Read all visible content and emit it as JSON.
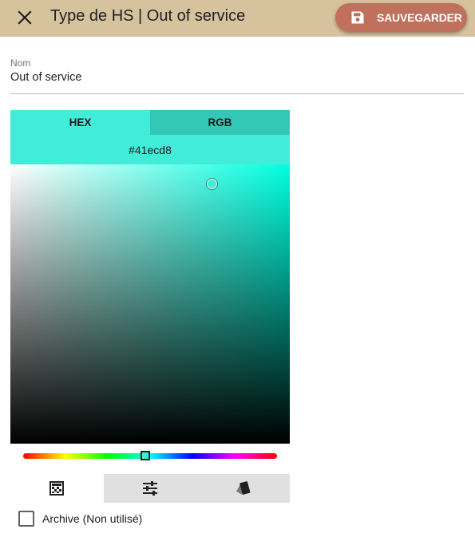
{
  "header": {
    "title": "Type de HS | Out of service",
    "close_icon": "close-icon",
    "save_label": "SAUVEGARDER",
    "save_icon": "floppy-disk-icon",
    "background_color": "#d7c29e",
    "save_color": "#c0715d"
  },
  "form": {
    "name_field": {
      "label": "Nom",
      "value": "Out of service"
    },
    "color_picker": {
      "tabs": [
        {
          "label": "HEX",
          "active": true
        },
        {
          "label": "RGB",
          "active": false
        }
      ],
      "hex_value": "#41ecd8",
      "hue_color": "#00ffe0",
      "view_tabs": [
        {
          "icon": "gradient-canvas-icon",
          "active": true
        },
        {
          "icon": "sliders-icon",
          "active": false
        },
        {
          "icon": "swatches-icon",
          "active": false
        }
      ]
    },
    "archive_checkbox": {
      "label": "Archive (Non utilisé)",
      "checked": false
    }
  }
}
